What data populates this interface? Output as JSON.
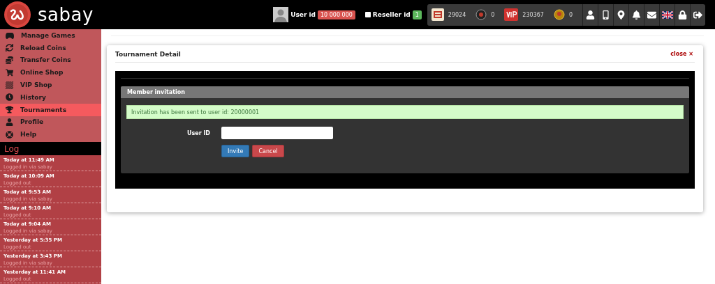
{
  "brand": {
    "name": "sabay"
  },
  "user": {
    "label": "User id",
    "id": "10 000 000"
  },
  "reseller": {
    "label": "Reseller id",
    "checked": false,
    "count": "1"
  },
  "wallet": [
    {
      "kind": "sabay-coin",
      "amount": "29024"
    },
    {
      "kind": "coin",
      "amount": "0"
    },
    {
      "kind": "vip",
      "amount": "230367"
    },
    {
      "kind": "gold",
      "amount": "0"
    }
  ],
  "toolbar": [
    {
      "kind": "profile"
    },
    {
      "kind": "mobile"
    },
    {
      "kind": "location"
    },
    {
      "kind": "notifications"
    },
    {
      "kind": "messages"
    },
    {
      "kind": "language"
    },
    {
      "kind": "lock"
    },
    {
      "kind": "logout"
    }
  ],
  "sidebar": {
    "items": [
      {
        "kind": "games",
        "label": "Manage Games",
        "selected": false
      },
      {
        "kind": "reload",
        "label": "Reload Coins",
        "selected": false
      },
      {
        "kind": "transfer",
        "label": "Transfer Coins",
        "selected": false
      },
      {
        "kind": "shop",
        "label": "Online Shop",
        "selected": false
      },
      {
        "kind": "vip",
        "label": "VIP Shop",
        "selected": false
      },
      {
        "kind": "history",
        "label": "History",
        "selected": false
      },
      {
        "kind": "trophy",
        "label": "Tournaments",
        "selected": true
      },
      {
        "kind": "profile",
        "label": "Profile",
        "selected": false
      },
      {
        "kind": "help",
        "label": "Help",
        "selected": false
      }
    ]
  },
  "log": {
    "title": "Log",
    "entries": [
      {
        "time": "Today at 11:49 AM",
        "action": "Logged in via sabay"
      },
      {
        "time": "Today at 10:09 AM",
        "action": "Logged out"
      },
      {
        "time": "Today at 9:53 AM",
        "action": "Logged in via sabay"
      },
      {
        "time": "Today at 9:10 AM",
        "action": "Logged out"
      },
      {
        "time": "Today at 9:04 AM",
        "action": "Logged in via sabay"
      },
      {
        "time": "Yesterday at 5:35 PM",
        "action": "Logged out"
      },
      {
        "time": "Yesterday at 3:43 PM",
        "action": "Logged in via sabay"
      },
      {
        "time": "Yesterday at 11:41 AM",
        "action": "Logged out"
      }
    ]
  },
  "card": {
    "title": "Tournament Detail",
    "close": "close",
    "close_icon": "×",
    "panel": {
      "title": "Member invitation",
      "alert": "Invitation has been sent to user id: 20000001",
      "field_label": "User ID",
      "buttons": [
        {
          "kind": "primary",
          "label": "Invite"
        },
        {
          "kind": "danger",
          "label": "Cancel"
        }
      ]
    }
  }
}
